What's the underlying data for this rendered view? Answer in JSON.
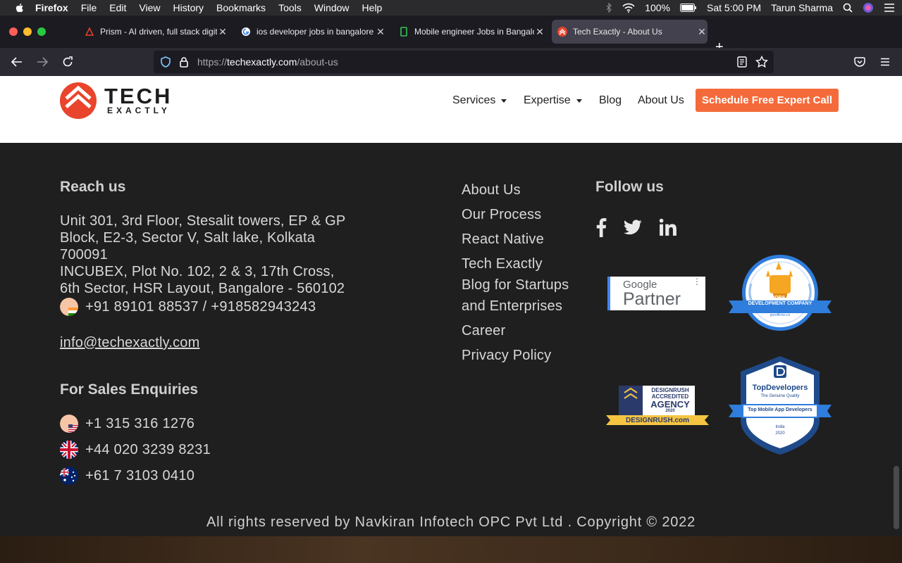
{
  "menubar": {
    "app_name": "Firefox",
    "items": [
      "File",
      "Edit",
      "View",
      "History",
      "Bookmarks",
      "Tools",
      "Window",
      "Help"
    ],
    "battery": "100%",
    "datetime": "Sat 5:00 PM",
    "user": "Tarun Sharma"
  },
  "tabs": [
    {
      "title": "Prism - AI driven, full stack digita",
      "favicon": "prism-icon"
    },
    {
      "title": "ios developer jobs in bangalore",
      "favicon": "google-icon"
    },
    {
      "title": "Mobile engineer Jobs in Bangalo",
      "favicon": "jobs-icon"
    },
    {
      "title": "Tech Exactly - About Us",
      "favicon": "techexactly-icon"
    }
  ],
  "address_bar": {
    "scheme": "https://",
    "domain": "techexactly.com",
    "path": "/about-us"
  },
  "site_header": {
    "logo_word1": "TECH",
    "logo_word2": "EXACTLY",
    "nav": {
      "services": "Services",
      "expertise": "Expertise",
      "blog": "Blog",
      "about": "About Us"
    },
    "cta": "Schedule Free Expert Call"
  },
  "footer": {
    "reach_heading": "Reach us",
    "address_lines": [
      "Unit 301, 3rd Floor, Stesalit towers, EP & GP",
      "Block, E2-3, Sector V, Salt lake, Kolkata",
      "700091",
      "INCUBEX, Plot No. 102, 2 & 3, 17th Cross,",
      "6th Sector, HSR Layout, Bangalore - 560102"
    ],
    "india_phone": "+91 89101 88537 / +918582943243",
    "email": "info@techexactly.com",
    "sales_heading": "For Sales Enquiries",
    "sales_phones": {
      "us": "+1 315 316 1276",
      "uk": "+44 020 3239 8231",
      "au": "+61 7 3103 0410"
    },
    "links": {
      "about": "About Us",
      "process": "Our Process",
      "react_native": "React Native",
      "blog_line1": "Tech Exactly",
      "blog_line2": "Blog for Startups",
      "blog_line3": "and Enterprises",
      "career": "Career",
      "privacy": "Privacy Policy"
    },
    "follow_heading": "Follow us",
    "social_icons": [
      "facebook-icon",
      "twitter-icon",
      "linkedin-icon"
    ],
    "badges": {
      "google_top": "Google",
      "google_bottom": "Partner",
      "goodfirms_line1": "TOP MOBILE APP",
      "goodfirms_line2": "DEVELOPMENT COMPANY",
      "goodfirms_site": "goodfirms.co",
      "designrush_line1": "DESIGNRUSH",
      "designrush_line2": "ACCREDITED",
      "designrush_line3": "AGENCY",
      "designrush_year": "2020",
      "designrush_site": "DESIGNRUSH.com",
      "topdev_title": "TopDevelopers",
      "topdev_sub": "The Genuine Quality",
      "topdev_ribbon": "Top Mobile App Developers",
      "topdev_country": "India",
      "topdev_year": "2020"
    },
    "copyright": "All rights reserved by Navkiran Infotech OPC Pvt Ltd . Copyright © 2022"
  },
  "colors": {
    "brand_orange": "#f56a3a",
    "logo_red": "#e8452c",
    "footer_bg": "#1f1f1f"
  }
}
